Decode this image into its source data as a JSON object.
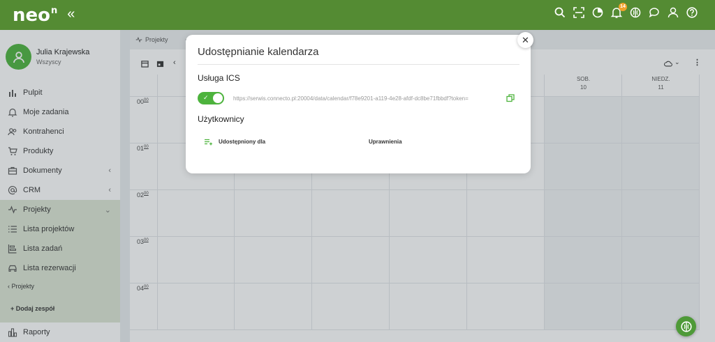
{
  "app": {
    "logo": "neo",
    "logo_sup": "n",
    "collapse_glyph": "«",
    "accent": "#548b33",
    "notifications_count": "14"
  },
  "topbar_icons": [
    "search-icon",
    "scan-icon",
    "chart-pie-icon",
    "bell-icon",
    "brain-icon",
    "chat-icon",
    "user-icon",
    "help-icon"
  ],
  "user": {
    "name": "Julia Krajewska",
    "subtitle": "Wszyscy"
  },
  "sidebar": {
    "items": [
      {
        "label": "Pulpit",
        "icon": "bar-chart-icon"
      },
      {
        "label": "Moje zadania",
        "icon": "bell-icon"
      },
      {
        "label": "Kontrahenci",
        "icon": "users-icon"
      },
      {
        "label": "Produkty",
        "icon": "cart-icon"
      },
      {
        "label": "Dokumenty",
        "icon": "briefcase-icon",
        "chevron": "‹"
      },
      {
        "label": "CRM",
        "icon": "at-icon",
        "chevron": "‹"
      },
      {
        "label": "Projekty",
        "icon": "pulse-icon",
        "chevron": "⌄"
      },
      {
        "label": "Lista projektów",
        "icon": "list-icon"
      },
      {
        "label": "Lista zadań",
        "icon": "tasks-icon"
      },
      {
        "label": "Lista rezerwacji",
        "icon": "car-icon"
      }
    ],
    "back_label": "‹  Projekty",
    "add_team": "+ Dodaj zespół",
    "reports": "Raporty"
  },
  "tabs": [
    "Projekty"
  ],
  "calendar": {
    "days": [
      {
        "name": "SOB.",
        "num": "10"
      },
      {
        "name": "NIEDZ.",
        "num": "11"
      }
    ],
    "hours": [
      "00",
      "01",
      "02",
      "03",
      "04"
    ],
    "hour_suffix": "00"
  },
  "modal": {
    "title": "Udostępnianie kalendarza",
    "section_ics": "Usługa ICS",
    "ics_url": "https://serwis.connecto.pl:20004/data/calendar/f78e9201-a119-4e28-afdf-dc8be71fbbdf?token=",
    "section_users": "Użytkownicy",
    "col_shared": "Udostępniony dla",
    "col_permissions": "Uprawnienia",
    "close_glyph": "✕",
    "toggle_check": "✓"
  }
}
